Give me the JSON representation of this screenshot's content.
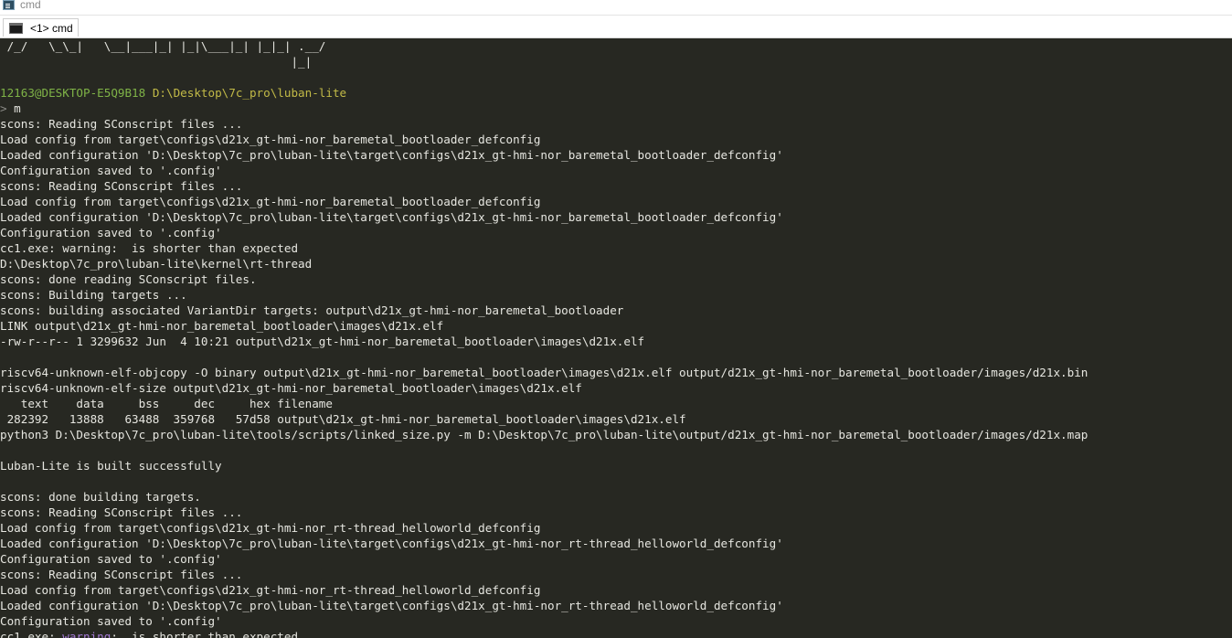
{
  "window": {
    "title": "cmd"
  },
  "tabs": [
    {
      "label": "<1> cmd"
    }
  ],
  "terminal": {
    "lines": [
      [
        {
          "t": " /_/   \\_\\_|   \\__|___|_| |_|\\___|_| |_|_| .__/"
        }
      ],
      [
        {
          "t": "                                          |_|"
        }
      ],
      [
        {
          "t": ""
        }
      ],
      [
        {
          "t": "12163@DESKTOP-E5Q9B18",
          "c": "user"
        },
        {
          "t": " "
        },
        {
          "t": "D:\\Desktop\\7c_pro\\luban-lite",
          "c": "path"
        }
      ],
      [
        {
          "t": ">",
          "c": "muted"
        },
        {
          "t": " m"
        }
      ],
      [
        {
          "t": "scons: Reading SConscript files ..."
        }
      ],
      [
        {
          "t": "Load config from target\\configs\\d21x_gt-hmi-nor_baremetal_bootloader_defconfig"
        }
      ],
      [
        {
          "t": "Loaded configuration 'D:\\Desktop\\7c_pro\\luban-lite\\target\\configs\\d21x_gt-hmi-nor_baremetal_bootloader_defconfig'"
        }
      ],
      [
        {
          "t": "Configuration saved to '.config'"
        }
      ],
      [
        {
          "t": "scons: Reading SConscript files ..."
        }
      ],
      [
        {
          "t": "Load config from target\\configs\\d21x_gt-hmi-nor_baremetal_bootloader_defconfig"
        }
      ],
      [
        {
          "t": "Loaded configuration 'D:\\Desktop\\7c_pro\\luban-lite\\target\\configs\\d21x_gt-hmi-nor_baremetal_bootloader_defconfig'"
        }
      ],
      [
        {
          "t": "Configuration saved to '.config'"
        }
      ],
      [
        {
          "t": "cc1.exe: warning:  is shorter than expected"
        }
      ],
      [
        {
          "t": "D:\\Desktop\\7c_pro\\luban-lite\\kernel\\rt-thread"
        }
      ],
      [
        {
          "t": "scons: done reading SConscript files."
        }
      ],
      [
        {
          "t": "scons: Building targets ..."
        }
      ],
      [
        {
          "t": "scons: building associated VariantDir targets: output\\d21x_gt-hmi-nor_baremetal_bootloader"
        }
      ],
      [
        {
          "t": "LINK output\\d21x_gt-hmi-nor_baremetal_bootloader\\images\\d21x.elf"
        }
      ],
      [
        {
          "t": "-rw-r--r-- 1 3299632 Jun  4 10:21 output\\d21x_gt-hmi-nor_baremetal_bootloader\\images\\d21x.elf"
        }
      ],
      [
        {
          "t": ""
        }
      ],
      [
        {
          "t": "riscv64-unknown-elf-objcopy -O binary output\\d21x_gt-hmi-nor_baremetal_bootloader\\images\\d21x.elf output/d21x_gt-hmi-nor_baremetal_bootloader/images/d21x.bin"
        }
      ],
      [
        {
          "t": "riscv64-unknown-elf-size output\\d21x_gt-hmi-nor_baremetal_bootloader\\images\\d21x.elf"
        }
      ],
      [
        {
          "t": "   text    data     bss     dec     hex filename"
        }
      ],
      [
        {
          "t": " 282392   13888   63488  359768   57d58 output\\d21x_gt-hmi-nor_baremetal_bootloader\\images\\d21x.elf"
        }
      ],
      [
        {
          "t": "python3 D:\\Desktop\\7c_pro\\luban-lite\\tools/scripts/linked_size.py -m D:\\Desktop\\7c_pro\\luban-lite\\output/d21x_gt-hmi-nor_baremetal_bootloader/images/d21x.map"
        }
      ],
      [
        {
          "t": ""
        }
      ],
      [
        {
          "t": "Luban-Lite is built successfully"
        }
      ],
      [
        {
          "t": ""
        }
      ],
      [
        {
          "t": "scons: done building targets."
        }
      ],
      [
        {
          "t": "scons: Reading SConscript files ..."
        }
      ],
      [
        {
          "t": "Load config from target\\configs\\d21x_gt-hmi-nor_rt-thread_helloworld_defconfig"
        }
      ],
      [
        {
          "t": "Loaded configuration 'D:\\Desktop\\7c_pro\\luban-lite\\target\\configs\\d21x_gt-hmi-nor_rt-thread_helloworld_defconfig'"
        }
      ],
      [
        {
          "t": "Configuration saved to '.config'"
        }
      ],
      [
        {
          "t": "scons: Reading SConscript files ..."
        }
      ],
      [
        {
          "t": "Load config from target\\configs\\d21x_gt-hmi-nor_rt-thread_helloworld_defconfig"
        }
      ],
      [
        {
          "t": "Loaded configuration 'D:\\Desktop\\7c_pro\\luban-lite\\target\\configs\\d21x_gt-hmi-nor_rt-thread_helloworld_defconfig'"
        }
      ],
      [
        {
          "t": "Configuration saved to '.config'"
        }
      ],
      [
        {
          "t": "cc1.exe: "
        },
        {
          "t": "warning",
          "c": "warn"
        },
        {
          "t": ":  is shorter than expected"
        }
      ]
    ]
  },
  "colors": {
    "background": "#272822",
    "foreground": "#e6e6e0",
    "user": "#7fb347",
    "path": "#c2ba47",
    "warning": "#a57bd6",
    "prompt": "#8a8a86"
  },
  "icons": {
    "app": "cmder-terminal-icon",
    "tab": "console-window-icon"
  }
}
